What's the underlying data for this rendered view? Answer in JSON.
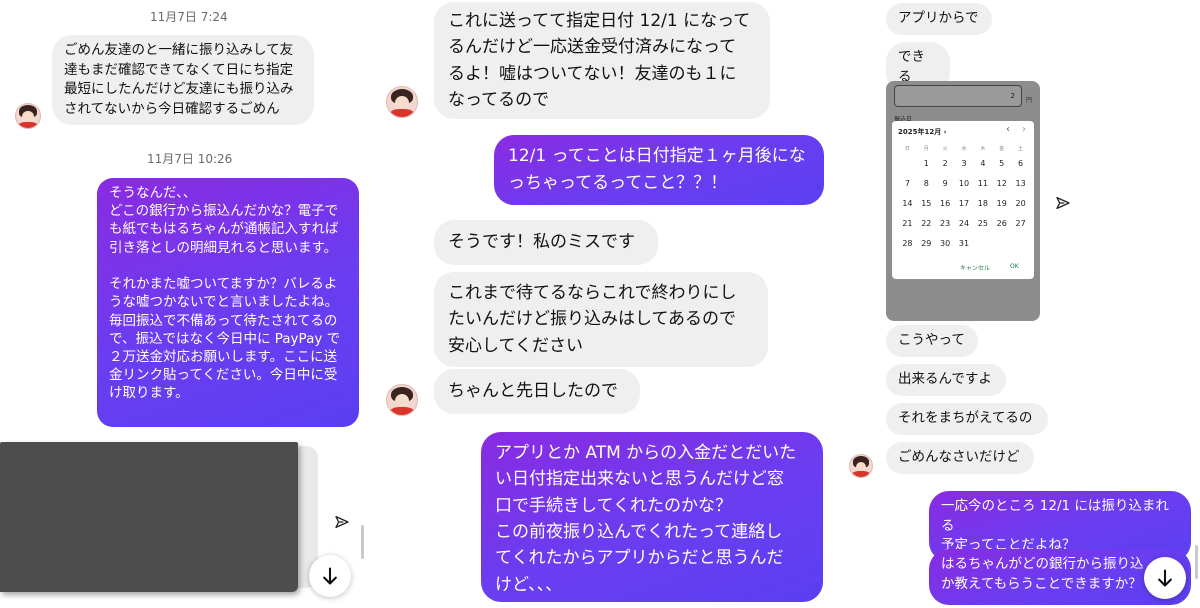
{
  "panel1": {
    "timestamp1": "11月7日 7:24",
    "msg1": "ごめん友達のと一緒に振り込みして友\n達もまだ確認できてなくて日にち指定\n最短にしたんだけど友達にも振り込み\nされてないから今日確認するごめん",
    "timestamp2": "11月7日 10:26",
    "msg2": "そうなんだ、、\nどこの銀行から振込んだかな？電子で\nも紙でもはるちゃんが通帳記入すれば\n引き落としの明細見れると思います。\n\nそれかまた嘘ついてますか？バレるよ\nうな嘘つかないでと言いましたよね。\n毎回振込で不備あって待たされてるの\nで、振込ではなく今日中に PayPay で\n２万送金対応お願いします。ここに送\n金リンク貼ってください。今日中に受\nけ取ります。"
  },
  "panel2": {
    "msg1": "これに送ってて指定日付 12/1 になって\nるんだけど一応送金受付済みになって\nるよ！嘘はついてない！友達のも１に\nなってるので",
    "msg2": "12/1 ってことは日付指定１ヶ月後にな\nっちゃってるってこと？？！",
    "msg3": "そうです！私のミスです",
    "msg4": "これまで待てるならこれで終わりにし\nたいんだけど振り込みはしてあるので\n安心してください",
    "msg5": "ちゃんと先日したので",
    "msg6": "アプリとか ATM からの入金だとだいた\nい日付指定出来ないと思うんだけど窓\n口で手続きしてくれたのかな？\nこの前夜振り込んでくれたって連絡し\nてくれたからアプリからだと思うんだ\nけど、、、"
  },
  "panel3": {
    "msg1": "アプリからで",
    "msg2": "できる",
    "msg3": "こうやって",
    "msg4": "出来るんですよ",
    "msg5": "それをまちがえてるの",
    "msg6": "ごめんなさいだけど",
    "msg7": "一応今のところ 12/1 には振り込まれる\n予定ってことだよね？",
    "msg8": "はるちゃんがどの銀行から振り込\nか教えてもらうことできますか？",
    "screenshot": {
      "amount": "2",
      "yen": "円",
      "date_label": "振込日",
      "month": "2025年12月 ›",
      "weekdays": [
        "日",
        "月",
        "火",
        "水",
        "木",
        "金",
        "土"
      ],
      "weeks": [
        [
          "",
          "1",
          "2",
          "3",
          "4",
          "5",
          "6"
        ],
        [
          "7",
          "8",
          "9",
          "10",
          "11",
          "12",
          "13"
        ],
        [
          "14",
          "15",
          "16",
          "17",
          "18",
          "19",
          "20"
        ],
        [
          "21",
          "22",
          "23",
          "24",
          "25",
          "26",
          "27"
        ],
        [
          "28",
          "29",
          "30",
          "31",
          "",
          "",
          ""
        ]
      ],
      "cancel": "キャンセル",
      "ok": "OK"
    }
  },
  "icons": {
    "send": "paper-plane-icon",
    "scroll_down": "arrow-down-icon"
  },
  "colors": {
    "outgoing_start": "#8a2be2",
    "outgoing_end": "#5b3ff2",
    "incoming": "#efefef"
  }
}
